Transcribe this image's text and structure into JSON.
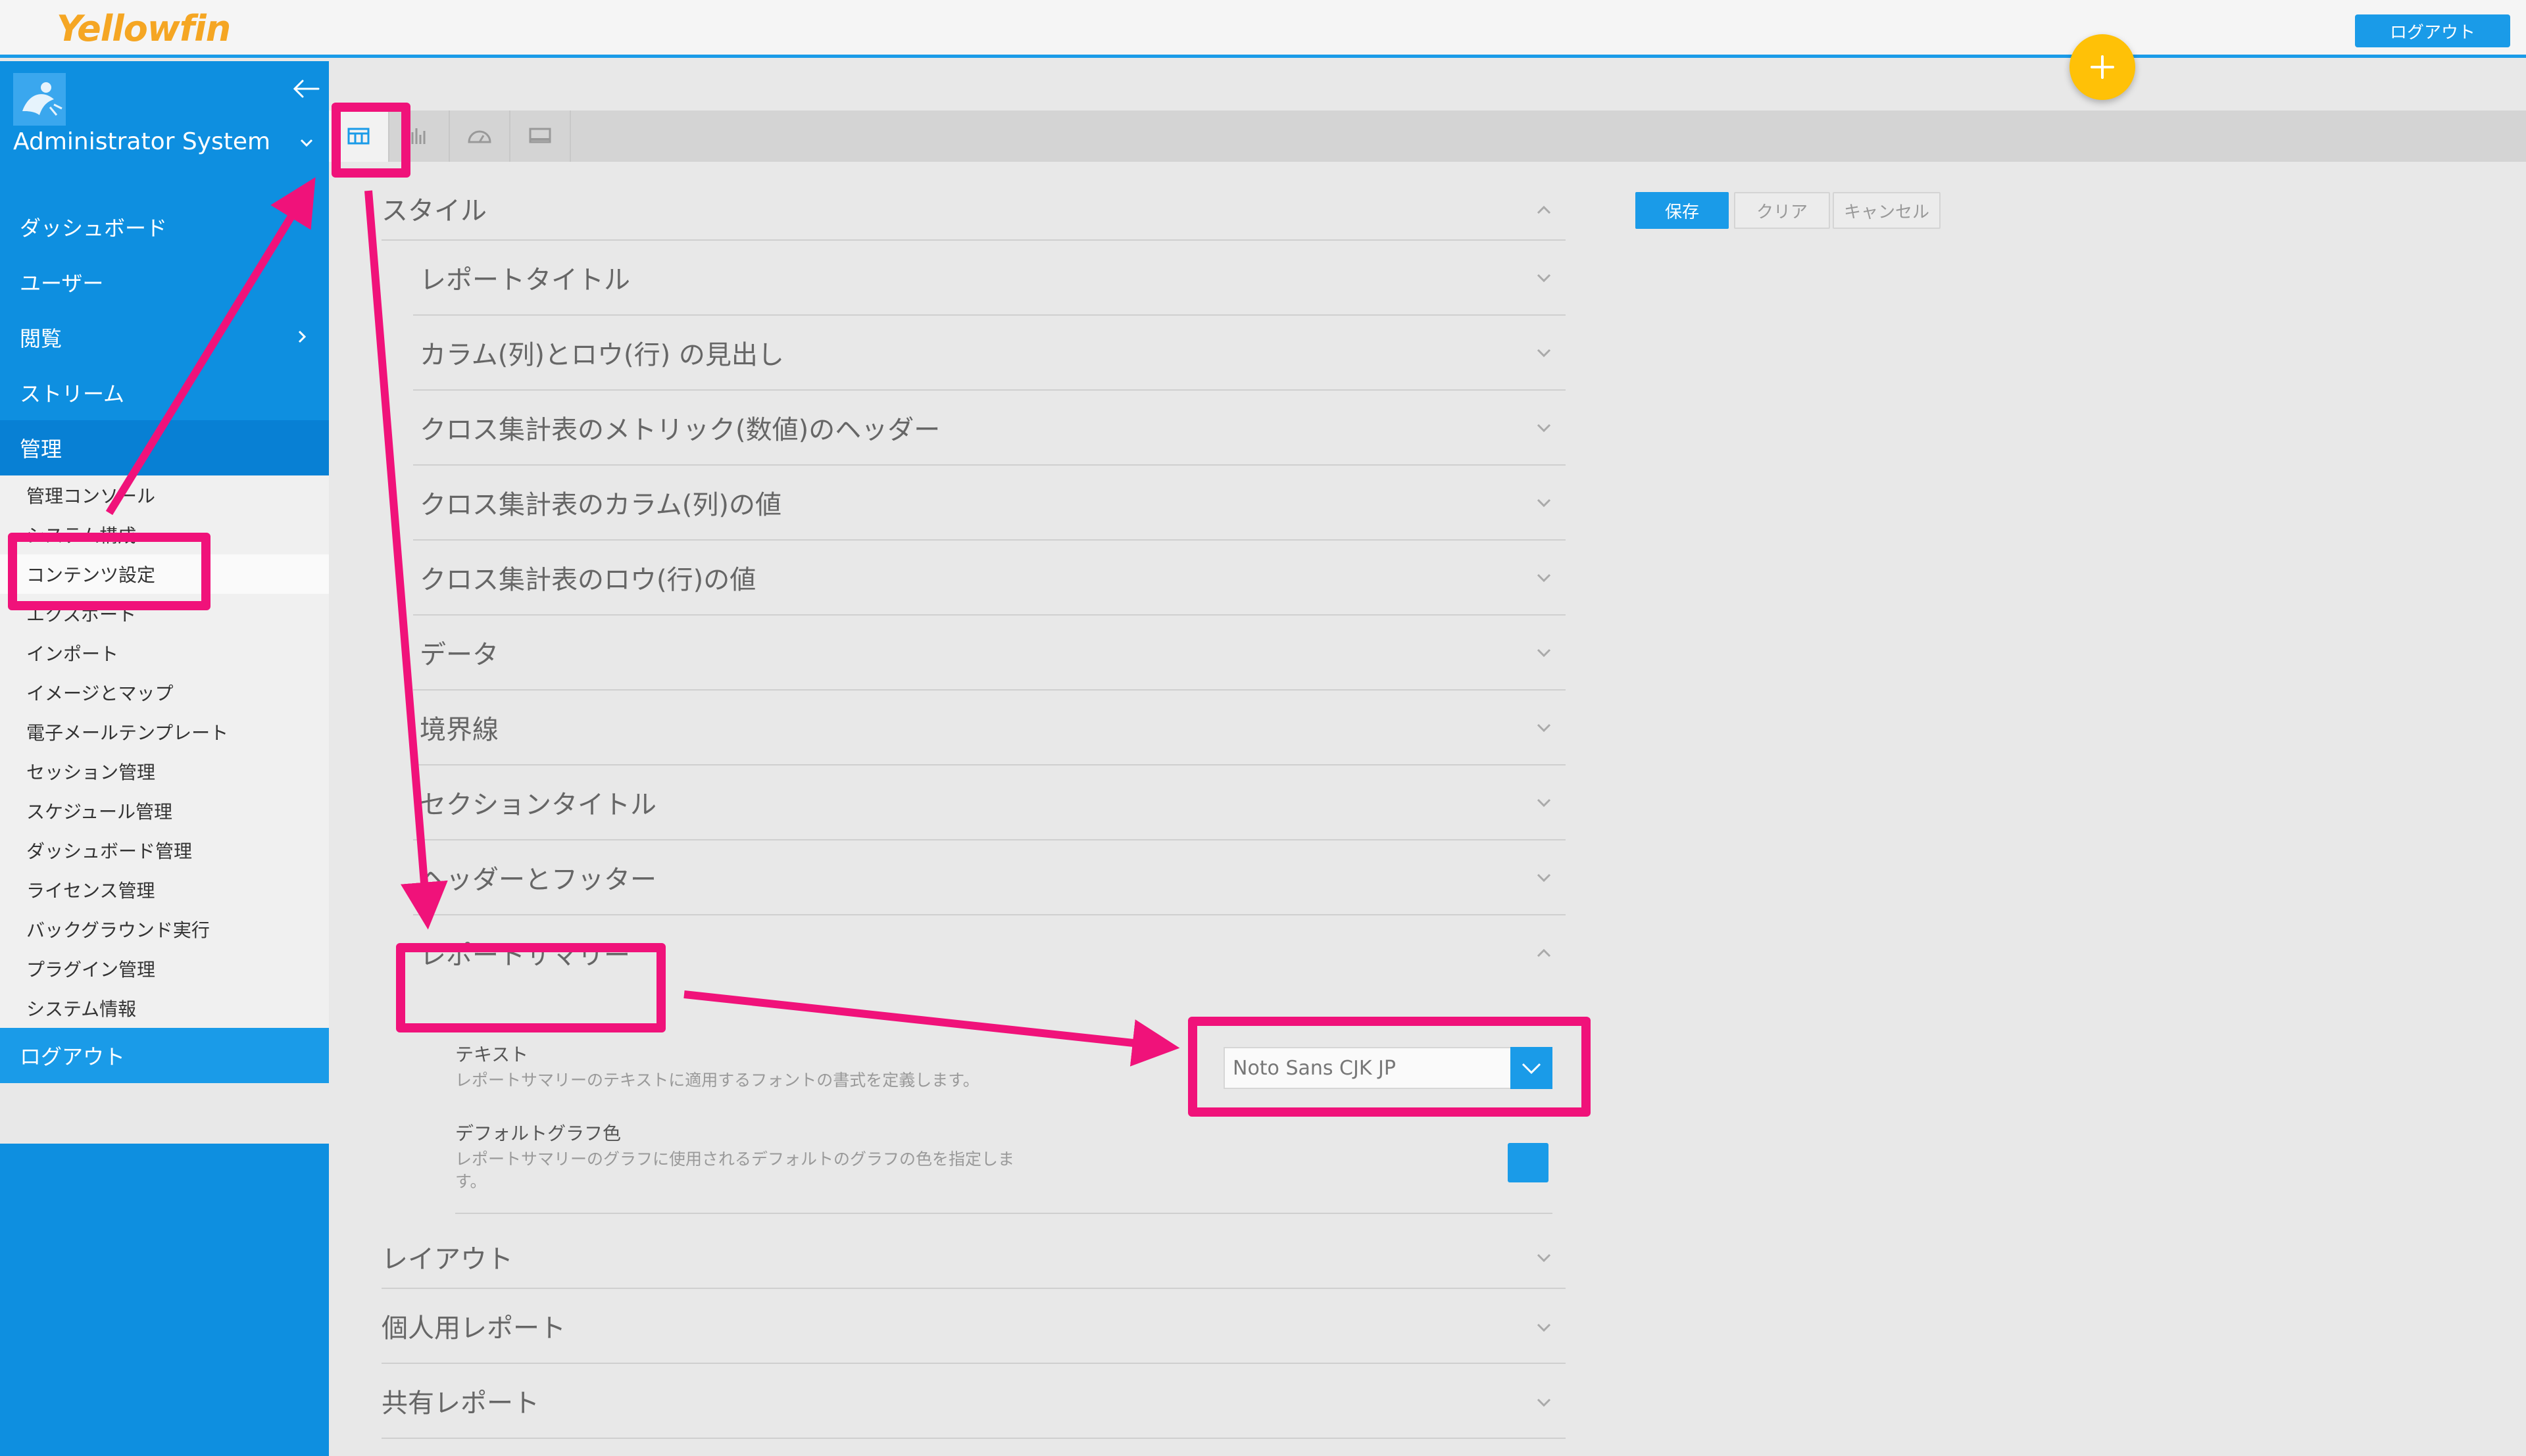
{
  "app": {
    "logo_text": "Yellowfin",
    "logout_label": "ログアウト"
  },
  "sidebar": {
    "user_name": "Administrator System",
    "menu": [
      {
        "label": "ダッシュボード"
      },
      {
        "label": "ユーザー"
      },
      {
        "label": "閲覧"
      },
      {
        "label": "ストリーム"
      },
      {
        "label": "管理"
      }
    ],
    "admin_items": [
      {
        "label": "管理コンソール"
      },
      {
        "label": "システム構成"
      },
      {
        "label": "コンテンツ設定"
      },
      {
        "label": "エクスポート"
      },
      {
        "label": "インポート"
      },
      {
        "label": "イメージとマップ"
      },
      {
        "label": "電子メールテンプレート"
      },
      {
        "label": "セッション管理"
      },
      {
        "label": "スケジュール管理"
      },
      {
        "label": "ダッシュボード管理"
      },
      {
        "label": "ライセンス管理"
      },
      {
        "label": "バックグラウンド実行"
      },
      {
        "label": "プラグイン管理"
      },
      {
        "label": "システム情報"
      }
    ],
    "logout_label": "ログアウト"
  },
  "tabs": [
    {
      "icon": "table-icon"
    },
    {
      "icon": "bar-chart-icon"
    },
    {
      "icon": "gauge-icon"
    },
    {
      "icon": "monitor-icon"
    }
  ],
  "actions": {
    "save": "保存",
    "clear": "クリア",
    "cancel": "キャンセル"
  },
  "settings": {
    "style_heading": "スタイル",
    "style_items": [
      {
        "label": "レポートタイトル"
      },
      {
        "label": "カラム(列)とロウ(行) の見出し"
      },
      {
        "label": "クロス集計表のメトリック(数値)のヘッダー"
      },
      {
        "label": "クロス集計表のカラム(列)の値"
      },
      {
        "label": "クロス集計表のロウ(行)の値"
      },
      {
        "label": "データ"
      },
      {
        "label": "境界線"
      },
      {
        "label": "セクションタイトル"
      },
      {
        "label": "ヘッダーとフッター"
      },
      {
        "label": "レポートサマリー"
      }
    ],
    "report_summary": {
      "text_label": "テキスト",
      "text_desc": "レポートサマリーのテキストに適用するフォントの書式を定義します。",
      "font_value": "Noto Sans CJK JP",
      "graph_color_label": "デフォルトグラフ色",
      "graph_color_desc_1": "レポートサマリーのグラフに使用されるデフォルトのグラフの色を指定しま",
      "graph_color_desc_2": "す。",
      "graph_color_value": "#1a9be8"
    },
    "other_sections": [
      {
        "label": "レイアウト"
      },
      {
        "label": "個人用レポート"
      },
      {
        "label": "共有レポート"
      }
    ]
  },
  "colors": {
    "primary": "#1a9be8",
    "sidebar": "#0e8fe0",
    "highlight": "#f0127a",
    "fab": "#ffc107"
  }
}
